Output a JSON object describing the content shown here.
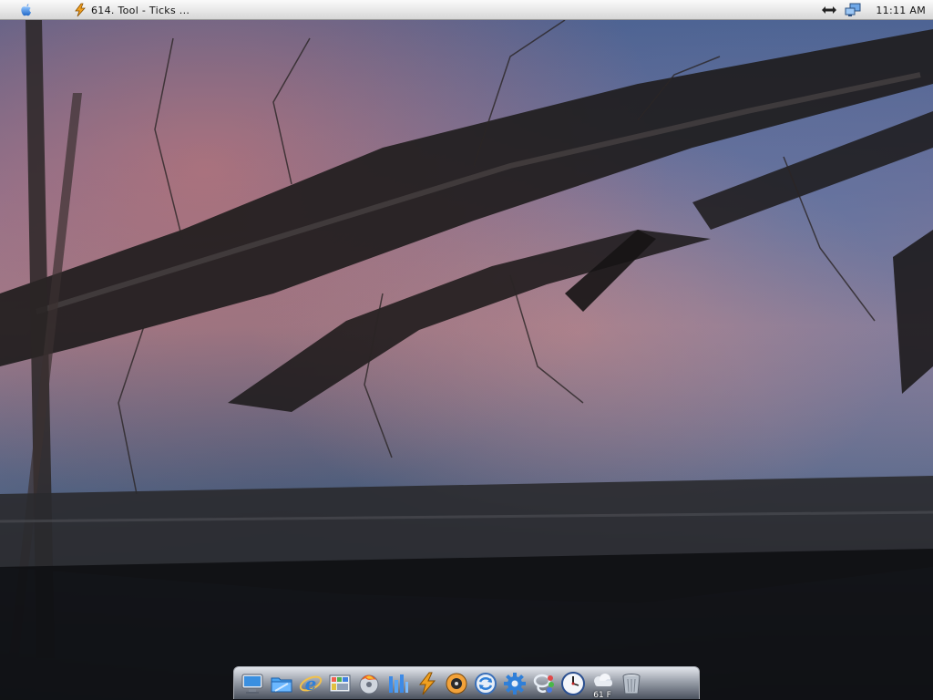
{
  "menubar": {
    "app_title": "614. Tool - Ticks ...",
    "clock": "11:11 AM",
    "icons": {
      "apple": "apple-logo-icon",
      "app": "lightning-bolt-icon",
      "network": "network-arrows-icon",
      "display": "display-monitor-icon"
    }
  },
  "wallpaper": {
    "description_icon": "desktop-wallpaper"
  },
  "dock": {
    "items": [
      {
        "name": "finder",
        "icon": "monitor-icon"
      },
      {
        "name": "folder",
        "icon": "folder-icon"
      },
      {
        "name": "internet-explorer",
        "icon": "browser-e-icon"
      },
      {
        "name": "grid-app",
        "icon": "grid-app-icon"
      },
      {
        "name": "burn-disc",
        "icon": "fire-disc-icon"
      },
      {
        "name": "chart-app",
        "icon": "chart-bars-icon"
      },
      {
        "name": "bolt-app",
        "icon": "lightning-bolt-icon"
      },
      {
        "name": "media-player",
        "icon": "media-disc-icon"
      },
      {
        "name": "sync-app",
        "icon": "sync-arrows-icon"
      },
      {
        "name": "settings",
        "icon": "gear-icon"
      },
      {
        "name": "lasso-app",
        "icon": "lasso-icon"
      },
      {
        "name": "clock",
        "icon": "clock-icon"
      },
      {
        "name": "weather",
        "icon": "weather-cloud-icon",
        "label": "61 F"
      },
      {
        "name": "trash",
        "icon": "trash-icon"
      }
    ]
  },
  "colors": {
    "menubar_bg": "#e6e6e6",
    "dock_top": "#e3e6ec",
    "dock_bottom": "#4b525e",
    "accent_blue": "#2f7fd8",
    "bolt_orange": "#f0a020"
  }
}
